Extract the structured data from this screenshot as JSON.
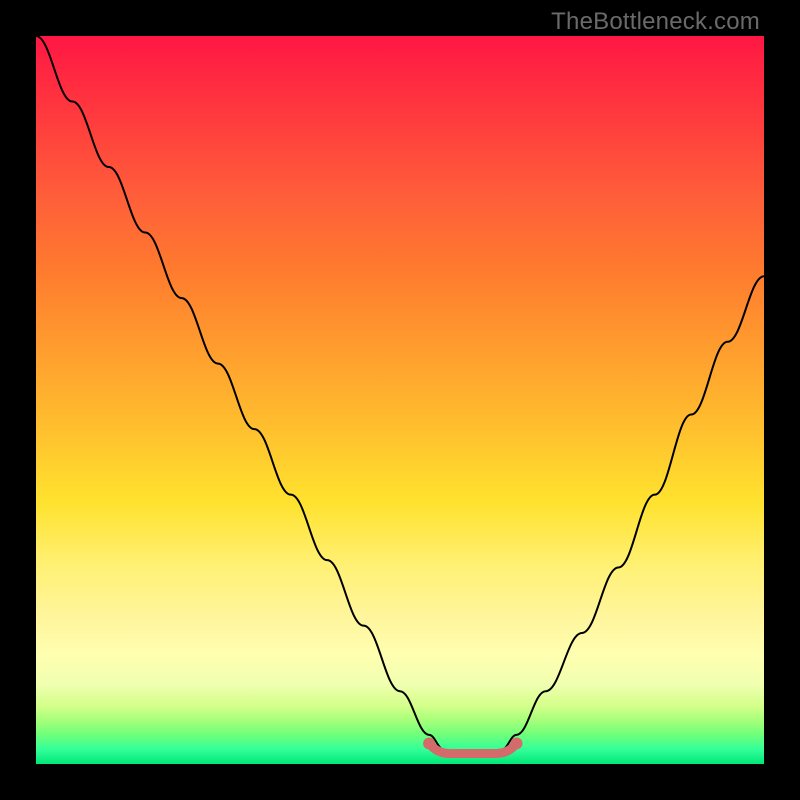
{
  "attribution": "TheBottleneck.com",
  "colors": {
    "flat_segment": "#d46a6a",
    "curve": "#000000",
    "gradient_top": "#ff1744",
    "gradient_bottom": "#00e676",
    "frame": "#000000"
  },
  "chart_data": {
    "type": "line",
    "title": "",
    "xlabel": "",
    "ylabel": "",
    "xlim": [
      0,
      100
    ],
    "ylim": [
      0,
      100
    ],
    "x": [
      0,
      5,
      10,
      15,
      20,
      25,
      30,
      35,
      40,
      45,
      50,
      54,
      56,
      58,
      60,
      62,
      64,
      66,
      70,
      75,
      80,
      85,
      90,
      95,
      100
    ],
    "values": [
      100,
      91,
      82,
      73,
      64,
      55,
      46,
      37,
      28,
      19,
      10,
      4,
      2,
      1,
      1,
      1,
      2,
      4,
      10,
      18,
      27,
      37,
      48,
      58,
      67
    ],
    "flat_region": {
      "x_start": 54,
      "x_end": 66,
      "y": 2
    },
    "annotations": []
  }
}
